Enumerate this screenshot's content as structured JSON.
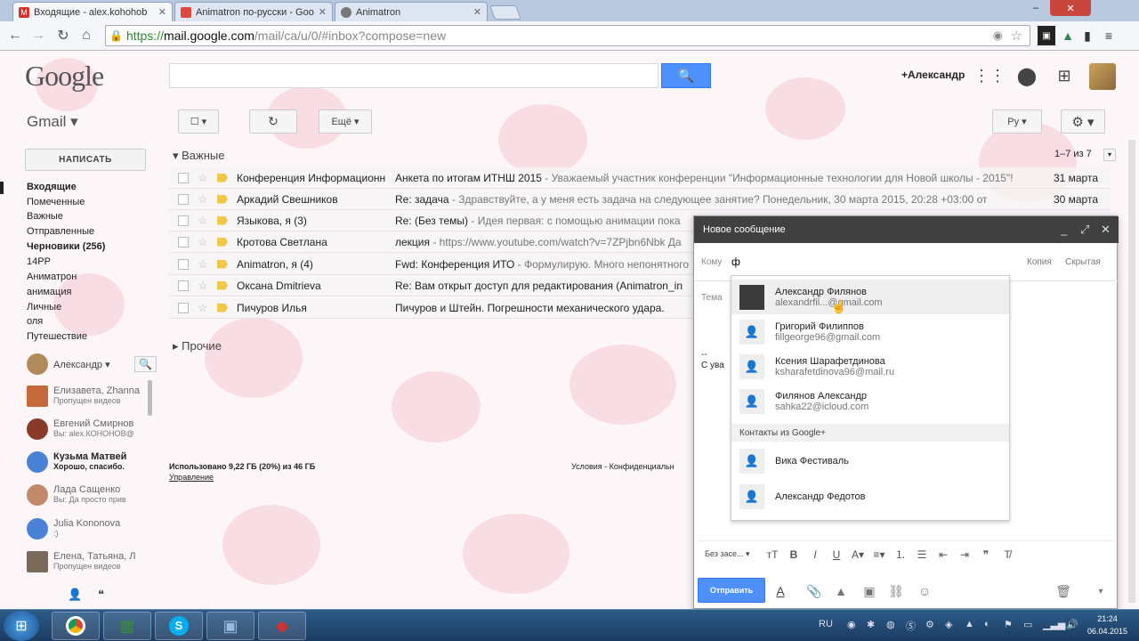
{
  "browser": {
    "tabs": [
      {
        "label": "Входящие - alex.kohohob",
        "icon_color": "#d93025",
        "active": true
      },
      {
        "label": "Animatron по-русски - Goo",
        "icon_color": "#dd4b39",
        "active": false
      },
      {
        "label": "Animatron",
        "icon_color": "#555555",
        "active": false
      }
    ],
    "url_scheme": "https://",
    "url_host": "mail.google.com",
    "url_path": "/mail/ca/u/0/#inbox?compose=new",
    "window_controls": [
      "‒",
      "✕"
    ]
  },
  "header": {
    "logo": "Google",
    "user_link": "+Александр"
  },
  "gmail": {
    "label": "Gmail ▾",
    "compose_label": "НАПИСАТЬ",
    "toolbar": {
      "more_label": "Ещё ▾",
      "lang_label": "Ру"
    },
    "nav": [
      {
        "label": "Входящие",
        "bold": true
      },
      {
        "label": "Помеченные",
        "bold": false
      },
      {
        "label": "Важные",
        "bold": false
      },
      {
        "label": "Отправленные",
        "bold": false
      },
      {
        "label": "Черновики (256)",
        "bold": true
      },
      {
        "label": "14РР",
        "bold": false
      },
      {
        "label": "Аниматрон",
        "bold": false
      },
      {
        "label": "анимация",
        "bold": false
      },
      {
        "label": "Личные",
        "bold": false
      },
      {
        "label": "оля",
        "bold": false
      },
      {
        "label": "Путешествие",
        "bold": false
      }
    ]
  },
  "hangouts": {
    "self_name": "Александр ▾",
    "contacts": [
      {
        "name": "Елизавета, Zhanna",
        "sub": "Пропущен видеов",
        "bold": false,
        "color": "#c56a3a"
      },
      {
        "name": "Евгений Смирнов",
        "sub": "Вы: alex.КОНОНОВ@",
        "bold": false,
        "color": "#8a3a2a"
      },
      {
        "name": "Кузьма Матвей",
        "sub": "Хорошо, спасибо.",
        "bold": true,
        "color": "#4a82d8"
      },
      {
        "name": "Лада Сащенко",
        "sub": "Вы: Да просто прив",
        "bold": false,
        "color": "#c08a6a"
      },
      {
        "name": "Julia Kononova",
        "sub": ":)",
        "bold": false,
        "color": "#4a82d8"
      },
      {
        "name": "Елена, Татьяна, Л",
        "sub": "Пропущен видеов",
        "bold": false,
        "color": "#7a6a5a"
      }
    ]
  },
  "mail": {
    "important_label": "Важные",
    "other_label": "Прочие",
    "counter": "1–7 из 7",
    "rows": [
      {
        "from": "Конференция Информационн.",
        "subject": "Анкета по итогам ИТНШ 2015",
        "snippet": " - Уважаемый участник конференции \"Информационные технологии для Новой школы - 2015\"!",
        "date": "31 марта"
      },
      {
        "from": "Аркадий Свешников",
        "subject": "Re: задача",
        "snippet": " - Здравствуйте, а у меня есть задача на следующее занятие? Понедельник, 30 марта 2015, 20:28 +03:00 от",
        "date": "30 марта"
      },
      {
        "from": "Языкова, я (3)",
        "subject": "Re: (Без темы)",
        "snippet": " - Идея первая: с помощью анимации пока",
        "date": ""
      },
      {
        "from": "Кротова Светлана",
        "subject": "лекция",
        "snippet": " - https://www.youtube.com/watch?v=7ZPjbn6Nbk Да",
        "date": ""
      },
      {
        "from": "Animatron, я (4)",
        "subject": "Fwd: Конференция ИТО",
        "snippet": " - Формулирую. Много непонятного",
        "date": ""
      },
      {
        "from": "Оксана Dmitrieva",
        "subject": "Re: Вам открыт доступ для редактирования (Animatron_in",
        "snippet": "",
        "date": ""
      },
      {
        "from": "Пичуров Илья",
        "subject": "Пичуров и Штейн. Погрешности механического удара.",
        "snippet": "",
        "date": ""
      }
    ],
    "storage": "Использовано 9,22 ГБ (20%) из 46 ГБ",
    "manage": "Управление",
    "terms": "Условия - Конфиденциальн"
  },
  "compose": {
    "title": "Новое сообщение",
    "to_label": "Кому",
    "to_value": "ф",
    "cc_label": "Копия",
    "bcc_label": "Скрытая",
    "subject_label": "Тема",
    "signature_dash": "--",
    "signature": "С ува",
    "font_label": "Без засе... ▾",
    "send_label": "Отправить"
  },
  "autocomplete": {
    "suggestions": [
      {
        "name": "Александр Филянов",
        "email": "alexandrfil...@gmail.com",
        "selected": true,
        "photo": true
      },
      {
        "name": "Григорий Филиппов",
        "email": "fillgeorge96@gmail.com",
        "selected": false,
        "photo": false
      },
      {
        "name": "Ксения Шарафетдинова",
        "email": "ksharafetdinova96@mail.ru",
        "selected": false,
        "photo": false
      },
      {
        "name": "Филянов Александр",
        "email": "sahka22@icloud.com",
        "selected": false,
        "photo": false
      }
    ],
    "gplus_header": "Контакты из Google+",
    "gplus": [
      {
        "name": "Вика Фестиваль"
      },
      {
        "name": "Александр Федотов"
      }
    ]
  },
  "taskbar": {
    "lang": "RU",
    "time": "21:24",
    "date": "06.04.2015"
  },
  "colors": {
    "accent": "#4d90fe",
    "compose_title_bg": "#404040",
    "blossom": "#f6c8d4"
  }
}
